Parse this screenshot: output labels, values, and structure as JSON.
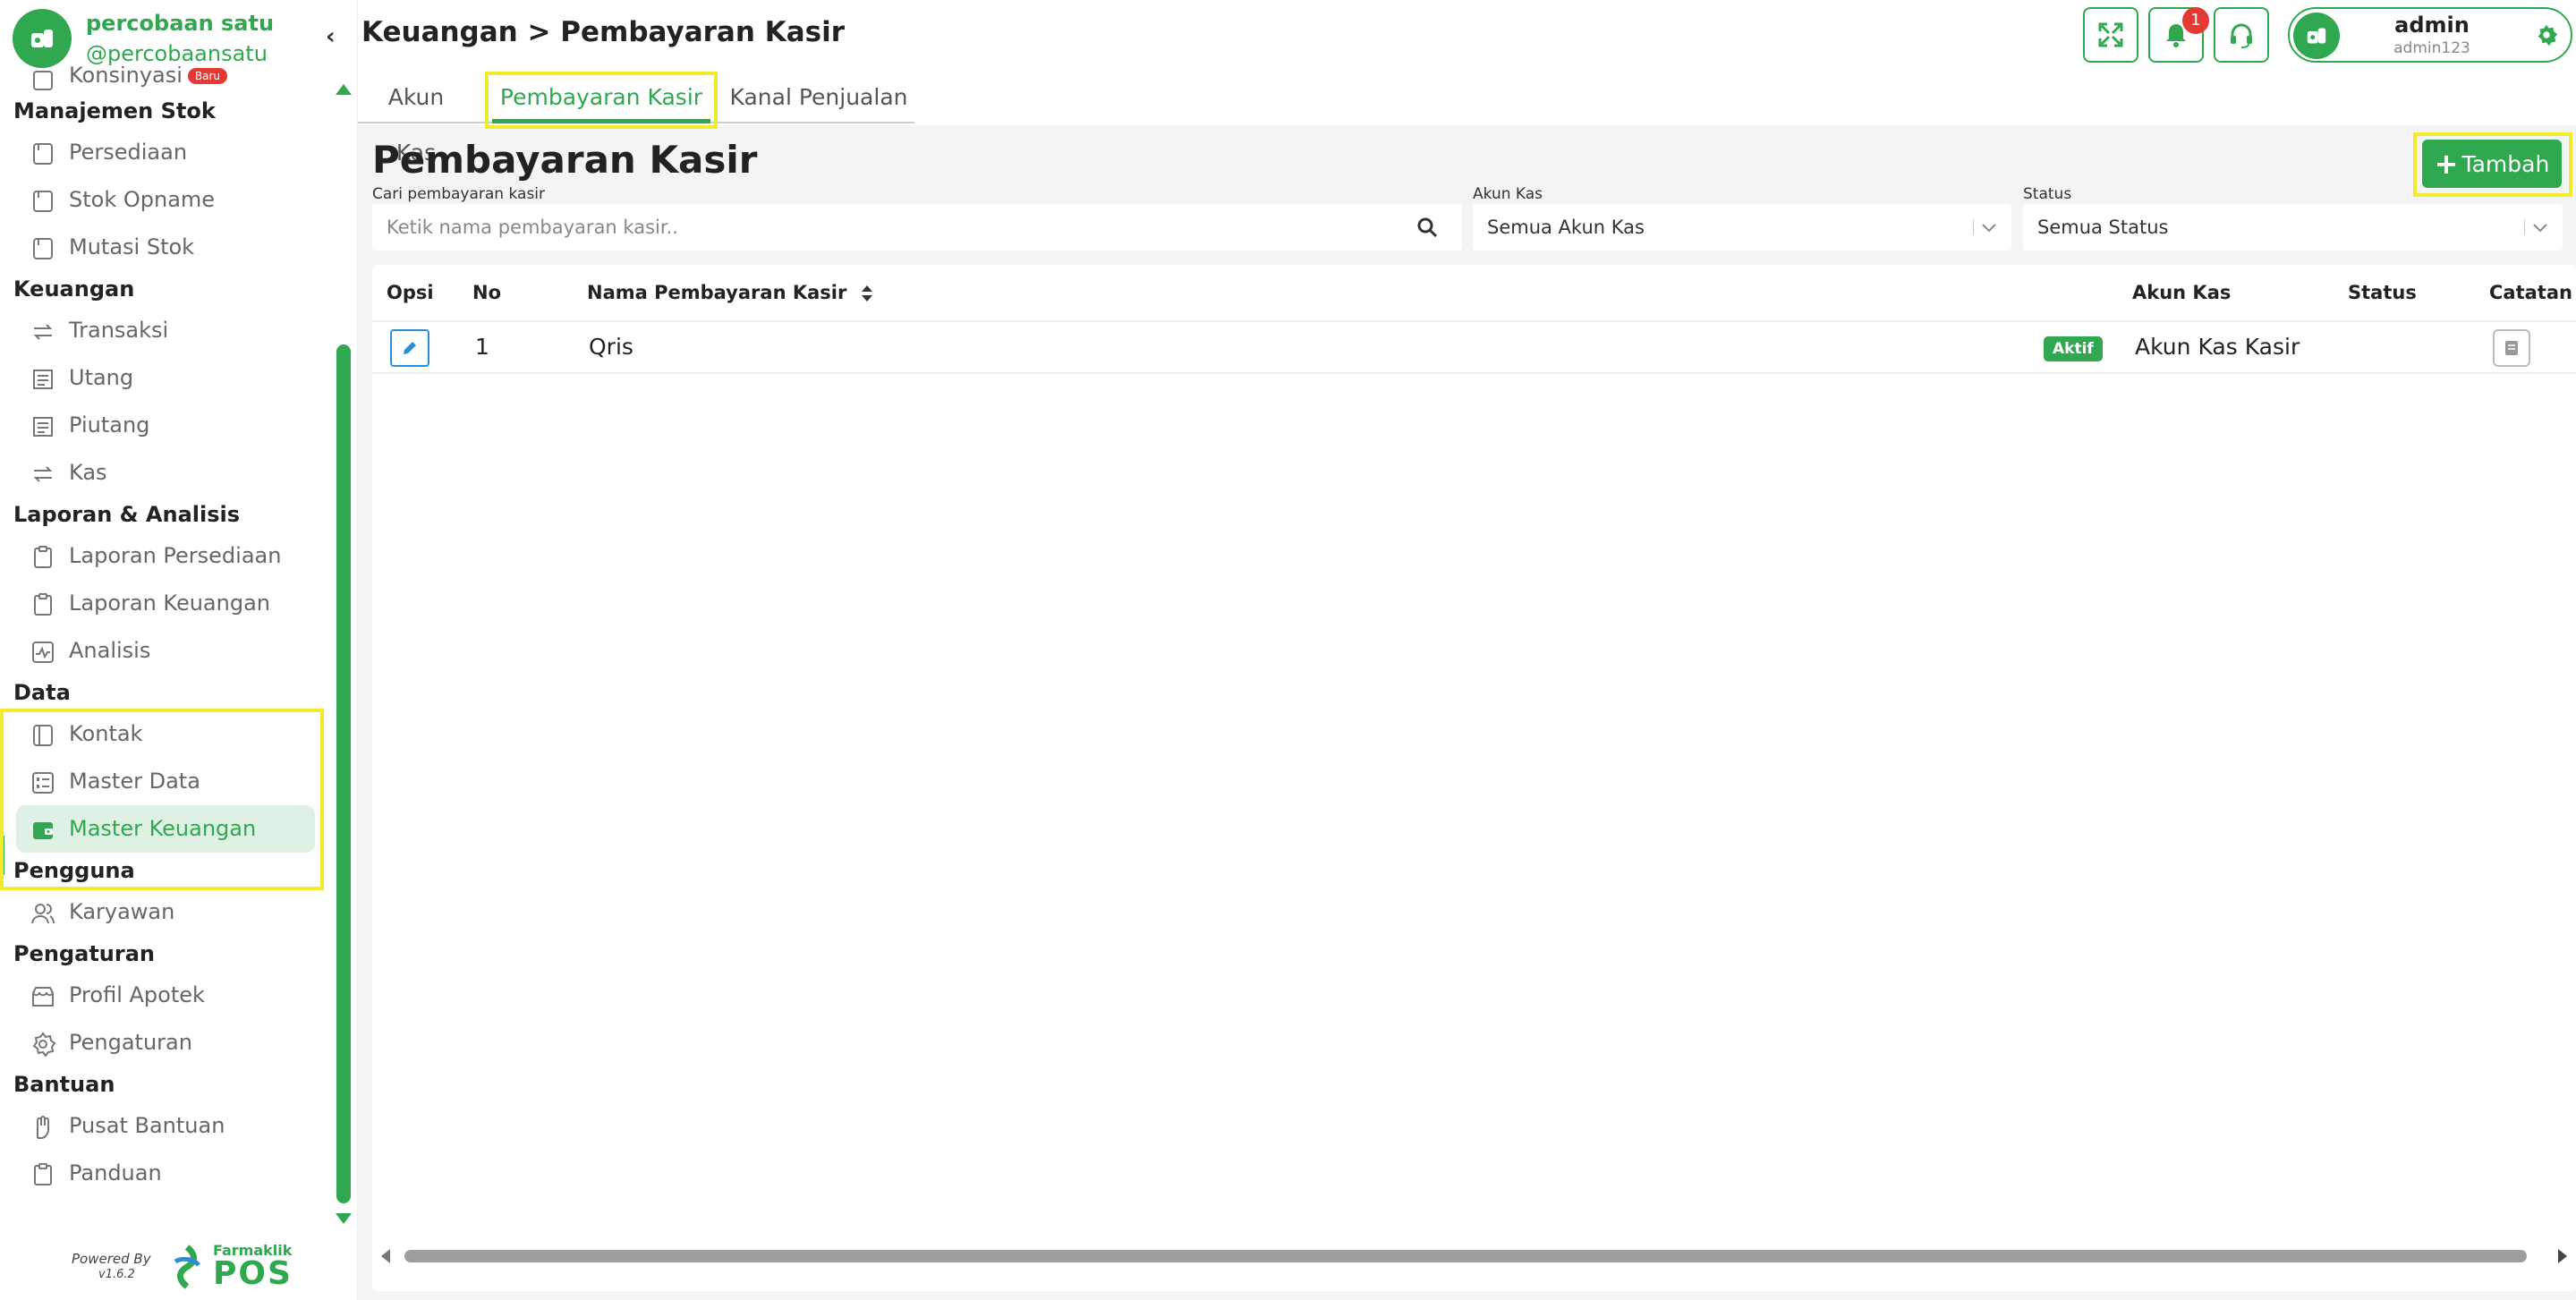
{
  "brand": {
    "name": "percobaan satu",
    "handle": "@percobaansatu"
  },
  "sidebar": {
    "partial_item": {
      "label": "Konsinyasi",
      "badge": "Baru"
    },
    "sections": [
      {
        "title": "Manajemen Stok",
        "items": [
          "Persediaan",
          "Stok Opname",
          "Mutasi Stok"
        ]
      },
      {
        "title": "Keuangan",
        "items": [
          "Transaksi",
          "Utang",
          "Piutang",
          "Kas"
        ]
      },
      {
        "title": "Laporan & Analisis",
        "items": [
          "Laporan Persediaan",
          "Laporan Keuangan",
          "Analisis"
        ]
      },
      {
        "title": "Data",
        "items": [
          "Kontak",
          "Master Data",
          "Master Keuangan"
        ]
      },
      {
        "title": "Pengguna",
        "items": [
          "Karyawan"
        ]
      },
      {
        "title": "Pengaturan",
        "items": [
          "Profil Apotek",
          "Pengaturan"
        ]
      },
      {
        "title": "Bantuan",
        "items": [
          "Pusat Bantuan",
          "Panduan"
        ]
      }
    ],
    "active_item": "Master Keuangan",
    "footer": {
      "powered_by": "Powered By",
      "version": "v1.6.2",
      "logo_small": "Farmaklik",
      "logo_big": "POS"
    }
  },
  "header": {
    "breadcrumb": "Keuangan > Pembayaran Kasir",
    "notification_count": "1",
    "user": {
      "name": "admin",
      "username": "admin123"
    }
  },
  "tabs": [
    "Akun Kas",
    "Pembayaran Kasir",
    "Kanal Penjualan"
  ],
  "active_tab": "Pembayaran Kasir",
  "page": {
    "title": "Pembayaran Kasir",
    "add_button": "Tambah",
    "filters": {
      "search_label": "Cari pembayaran kasir",
      "search_placeholder": "Ketik nama pembayaran kasir..",
      "akun_label": "Akun Kas",
      "akun_value": "Semua Akun Kas",
      "status_label": "Status",
      "status_value": "Semua Status"
    }
  },
  "table": {
    "columns": [
      "Opsi",
      "No",
      "Nama Pembayaran Kasir",
      "Akun Kas",
      "Status",
      "Catatan"
    ],
    "rows": [
      {
        "no": "1",
        "nama": "Qris",
        "akun": "Akun Kas Kasir",
        "status": "Aktif"
      }
    ]
  },
  "colors": {
    "accent": "#2fa84f",
    "highlight": "#f2ea2a",
    "danger": "#e53935",
    "edit": "#2b8ed8"
  },
  "icons": [
    "expand-icon",
    "bell-icon",
    "headset-icon",
    "gear-icon",
    "search-icon",
    "chevron-down-icon",
    "pencil-icon",
    "book-icon",
    "plus-icon"
  ]
}
